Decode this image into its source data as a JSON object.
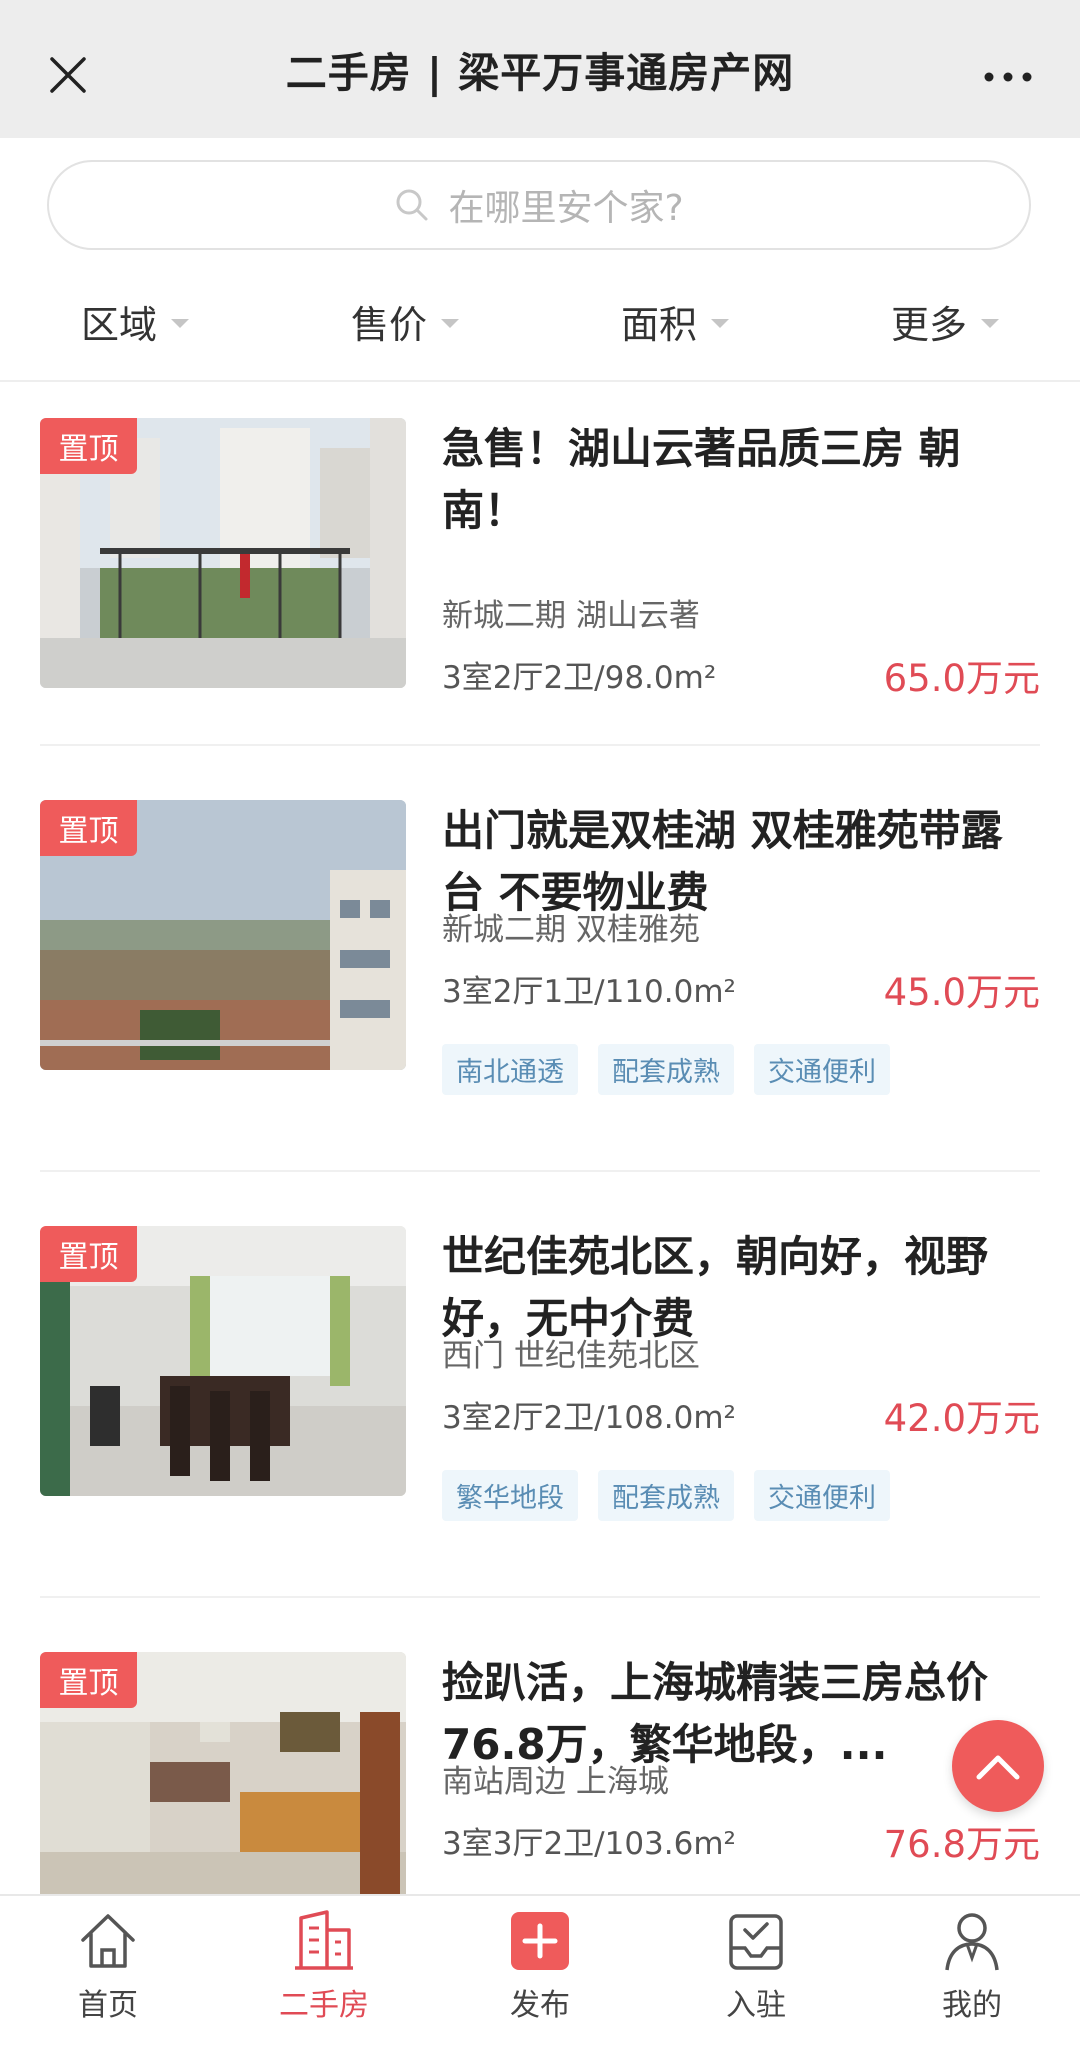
{
  "header": {
    "title": "二手房 | 梁平万事通房产网"
  },
  "search": {
    "placeholder": "在哪里安个家?"
  },
  "filters": [
    {
      "label": "区域"
    },
    {
      "label": "售价"
    },
    {
      "label": "面积"
    },
    {
      "label": "更多"
    }
  ],
  "listings": [
    {
      "badge": "置顶",
      "title": "急售！湖山云著品质三房 朝南！",
      "location": "新城二期 湖山云著",
      "spec": "3室2厅2卫/98.0m²",
      "price": "65.0万元",
      "tags": []
    },
    {
      "badge": "置顶",
      "title": "出门就是双桂湖 双桂雅苑带露台 不要物业费",
      "location": "新城二期 双桂雅苑",
      "spec": "3室2厅1卫/110.0m²",
      "price": "45.0万元",
      "tags": [
        "南北通透",
        "配套成熟",
        "交通便利"
      ]
    },
    {
      "badge": "置顶",
      "title": "世纪佳苑北区，朝向好，视野好，无中介费",
      "location": "西门 世纪佳苑北区",
      "spec": "3室2厅2卫/108.0m²",
      "price": "42.0万元",
      "tags": [
        "繁华地段",
        "配套成熟",
        "交通便利"
      ]
    },
    {
      "badge": "置顶",
      "title": "捡趴活，上海城精装三房总价76.8万，繁华地段，...",
      "location": "南站周边 上海城",
      "spec": "3室3厅2卫/103.6m²",
      "price": "76.8万元",
      "tags": []
    }
  ],
  "bottom_nav": [
    {
      "label": "首页",
      "icon": "home-icon"
    },
    {
      "label": "二手房",
      "icon": "building-icon",
      "active": true
    },
    {
      "label": "发布",
      "icon": "plus-icon"
    },
    {
      "label": "入驻",
      "icon": "inbox-check-icon"
    },
    {
      "label": "我的",
      "icon": "user-icon"
    }
  ],
  "colors": {
    "accent": "#e04b55",
    "badge": "#ef5b5b",
    "tag_text": "#5a8db4",
    "tag_bg": "#eef6fb"
  }
}
